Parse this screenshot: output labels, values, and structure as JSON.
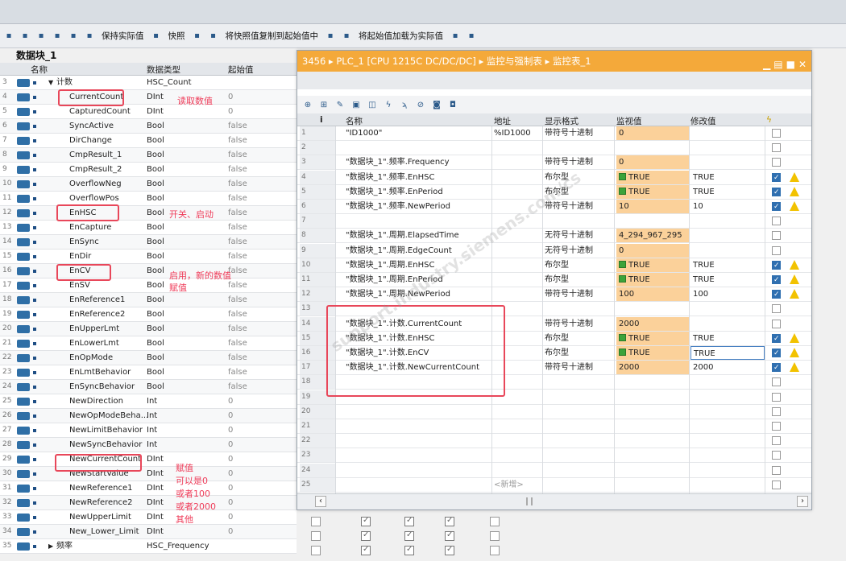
{
  "toolbar": {
    "items": [
      {
        "icon": "insert-row-icon"
      },
      {
        "icon": "add-row-icon"
      },
      {
        "icon": "expand-icon"
      },
      {
        "icon": "collapse-icon"
      },
      {
        "icon": "list-icon"
      },
      {
        "icon": "glasses-icon"
      },
      {
        "label": "保持实际值"
      },
      {
        "icon": "snapshot-icon"
      },
      {
        "label": "快照"
      },
      {
        "icon": "copy-icon"
      },
      {
        "icon": "copy2-icon"
      },
      {
        "label": "将快照值复制到起始值中"
      },
      {
        "icon": "load-icon"
      },
      {
        "icon": "load2-icon"
      },
      {
        "label": "将起始值加载为实际值"
      },
      {
        "icon": "extra-icon"
      },
      {
        "icon": "extra2-icon"
      }
    ]
  },
  "db": {
    "title": "数据块_1",
    "col_name": "名称",
    "col_type": "数据类型",
    "col_start": "起始值",
    "rows": [
      {
        "num": "3",
        "name": "计数",
        "type": "HSC_Count",
        "start": "",
        "group": true,
        "expand": "▼"
      },
      {
        "num": "4",
        "name": "CurrentCount",
        "type": "DInt",
        "start": "0"
      },
      {
        "num": "5",
        "name": "CapturedCount",
        "type": "DInt",
        "start": "0"
      },
      {
        "num": "6",
        "name": "SyncActive",
        "type": "Bool",
        "start": "false"
      },
      {
        "num": "7",
        "name": "DirChange",
        "type": "Bool",
        "start": "false"
      },
      {
        "num": "8",
        "name": "CmpResult_1",
        "type": "Bool",
        "start": "false"
      },
      {
        "num": "9",
        "name": "CmpResult_2",
        "type": "Bool",
        "start": "false"
      },
      {
        "num": "10",
        "name": "OverflowNeg",
        "type": "Bool",
        "start": "false"
      },
      {
        "num": "11",
        "name": "OverflowPos",
        "type": "Bool",
        "start": "false"
      },
      {
        "num": "12",
        "name": "EnHSC",
        "type": "Bool",
        "start": "false"
      },
      {
        "num": "13",
        "name": "EnCapture",
        "type": "Bool",
        "start": "false"
      },
      {
        "num": "14",
        "name": "EnSync",
        "type": "Bool",
        "start": "false"
      },
      {
        "num": "15",
        "name": "EnDir",
        "type": "Bool",
        "start": "false"
      },
      {
        "num": "16",
        "name": "EnCV",
        "type": "Bool",
        "start": "false"
      },
      {
        "num": "17",
        "name": "EnSV",
        "type": "Bool",
        "start": "false"
      },
      {
        "num": "18",
        "name": "EnReference1",
        "type": "Bool",
        "start": "false"
      },
      {
        "num": "19",
        "name": "EnReference2",
        "type": "Bool",
        "start": "false"
      },
      {
        "num": "20",
        "name": "EnUpperLmt",
        "type": "Bool",
        "start": "false"
      },
      {
        "num": "21",
        "name": "EnLowerLmt",
        "type": "Bool",
        "start": "false"
      },
      {
        "num": "22",
        "name": "EnOpMode",
        "type": "Bool",
        "start": "false"
      },
      {
        "num": "23",
        "name": "EnLmtBehavior",
        "type": "Bool",
        "start": "false"
      },
      {
        "num": "24",
        "name": "EnSyncBehavior",
        "type": "Bool",
        "start": "false"
      },
      {
        "num": "25",
        "name": "NewDirection",
        "type": "Int",
        "start": "0"
      },
      {
        "num": "26",
        "name": "NewOpModeBeha...",
        "type": "Int",
        "start": "0"
      },
      {
        "num": "27",
        "name": "NewLimitBehavior",
        "type": "Int",
        "start": "0"
      },
      {
        "num": "28",
        "name": "NewSyncBehavior",
        "type": "Int",
        "start": "0"
      },
      {
        "num": "29",
        "name": "NewCurrentCount",
        "type": "DInt",
        "start": "0"
      },
      {
        "num": "30",
        "name": "NewStartValue",
        "type": "DInt",
        "start": "0"
      },
      {
        "num": "31",
        "name": "NewReference1",
        "type": "DInt",
        "start": "0"
      },
      {
        "num": "32",
        "name": "NewReference2",
        "type": "DInt",
        "start": "0"
      },
      {
        "num": "33",
        "name": "NewUpperLimit",
        "type": "DInt",
        "start": "0"
      },
      {
        "num": "34",
        "name": "New_Lower_Limit",
        "type": "DInt",
        "start": "0"
      },
      {
        "num": "35",
        "name": "频率",
        "type": "HSC_Frequency",
        "start": "",
        "group": true,
        "expand": "▶"
      }
    ]
  },
  "annotations": {
    "read_count": "读取数值",
    "switch_start": "开关、启动",
    "enable_new_1": "启用，新的数值",
    "enable_new_2": "赋值",
    "assign": "赋值",
    "assign_0": "可以是0",
    "assign_100": "或者100",
    "assign_2000": "或者2000",
    "assign_other": "其他"
  },
  "monitor": {
    "breadcrumb": "3456 ▸ PLC_1 [CPU 1215C DC/DC/DC] ▸ 监控与强制表 ▸ 监控表_1",
    "head": {
      "i": "i",
      "name": "名称",
      "addr": "地址",
      "fmt": "显示格式",
      "mon": "监视值",
      "mod": "修改值"
    },
    "rows": [
      {
        "n": "1",
        "name": "\"ID1000\"",
        "addr": "%ID1000",
        "fmt": "带符号十进制",
        "mon": "0",
        "mod": "",
        "bool": false,
        "cb": false,
        "warn": false
      },
      {
        "n": "2",
        "name": "",
        "addr": "",
        "fmt": "",
        "mon": "",
        "mod": "",
        "blank": true
      },
      {
        "n": "3",
        "name": "\"数据块_1\".频率.Frequency",
        "addr": "",
        "fmt": "带符号十进制",
        "mon": "0",
        "mod": "",
        "cb": false
      },
      {
        "n": "4",
        "name": "\"数据块_1\".频率.EnHSC",
        "addr": "",
        "fmt": "布尔型",
        "mon": "TRUE",
        "mod": "TRUE",
        "bool": true,
        "cb": true,
        "warn": true
      },
      {
        "n": "5",
        "name": "\"数据块_1\".频率.EnPeriod",
        "addr": "",
        "fmt": "布尔型",
        "mon": "TRUE",
        "mod": "TRUE",
        "bool": true,
        "cb": true,
        "warn": true
      },
      {
        "n": "6",
        "name": "\"数据块_1\".频率.NewPeriod",
        "addr": "",
        "fmt": "带符号十进制",
        "mon": "10",
        "mod": "10",
        "cb": true,
        "warn": true
      },
      {
        "n": "7",
        "name": "",
        "addr": "",
        "fmt": "",
        "mon": "",
        "mod": "",
        "blank": true
      },
      {
        "n": "8",
        "name": "\"数据块_1\".周期.ElapsedTime",
        "addr": "",
        "fmt": "无符号十进制",
        "mon": "4_294_967_295",
        "mod": "",
        "cb": false
      },
      {
        "n": "9",
        "name": "\"数据块_1\".周期.EdgeCount",
        "addr": "",
        "fmt": "无符号十进制",
        "mon": "0",
        "mod": "",
        "cb": false
      },
      {
        "n": "10",
        "name": "\"数据块_1\".周期.EnHSC",
        "addr": "",
        "fmt": "布尔型",
        "mon": "TRUE",
        "mod": "TRUE",
        "bool": true,
        "cb": true,
        "warn": true
      },
      {
        "n": "11",
        "name": "\"数据块_1\".周期.EnPeriod",
        "addr": "",
        "fmt": "布尔型",
        "mon": "TRUE",
        "mod": "TRUE",
        "bool": true,
        "cb": true,
        "warn": true
      },
      {
        "n": "12",
        "name": "\"数据块_1\".周期.NewPeriod",
        "addr": "",
        "fmt": "带符号十进制",
        "mon": "100",
        "mod": "100",
        "cb": true,
        "warn": true
      },
      {
        "n": "13",
        "name": "",
        "addr": "",
        "fmt": "",
        "mon": "",
        "mod": "",
        "blank": true
      },
      {
        "n": "14",
        "name": "\"数据块_1\".计数.CurrentCount",
        "addr": "",
        "fmt": "带符号十进制",
        "mon": "2000",
        "mod": "",
        "cb": false
      },
      {
        "n": "15",
        "name": "\"数据块_1\".计数.EnHSC",
        "addr": "",
        "fmt": "布尔型",
        "mon": "TRUE",
        "mod": "TRUE",
        "bool": true,
        "cb": true,
        "warn": true
      },
      {
        "n": "16",
        "name": "\"数据块_1\".计数.EnCV",
        "addr": "",
        "fmt": "布尔型",
        "mon": "TRUE",
        "mod": "TRUE",
        "bool": true,
        "cb": true,
        "warn": true,
        "edit": true
      },
      {
        "n": "17",
        "name": "\"数据块_1\".计数.NewCurrentCount",
        "addr": "",
        "fmt": "带符号十进制",
        "mon": "2000",
        "mod": "2000",
        "cb": true,
        "warn": true
      },
      {
        "n": "18",
        "blank": true
      },
      {
        "n": "19",
        "blank": true
      },
      {
        "n": "20",
        "blank": true
      },
      {
        "n": "21",
        "blank": true
      },
      {
        "n": "22",
        "blank": true
      },
      {
        "n": "23",
        "blank": true
      },
      {
        "n": "24",
        "blank": true
      },
      {
        "n": "25",
        "name": "",
        "addr": "<新增>",
        "blank": true
      }
    ]
  },
  "watermark": "support.industry.siemens.com/cs"
}
